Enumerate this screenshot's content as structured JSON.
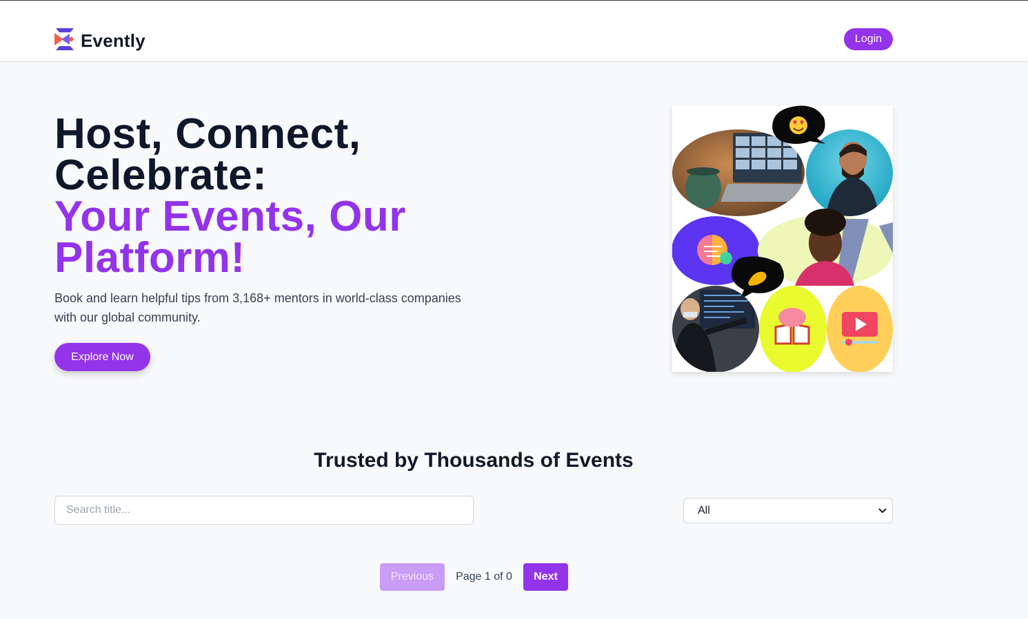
{
  "header": {
    "brand": "Evently",
    "login_label": "Login"
  },
  "hero": {
    "title_line1": "Host, Connect,",
    "title_line2": "Celebrate:",
    "accent_line1": "Your Events, Our",
    "accent_line2": "Platform!",
    "subtitle": "Book and learn helpful tips from 3,168+ mentors in world-class companies with our global community.",
    "cta_label": "Explore Now"
  },
  "events": {
    "section_title": "Trusted by Thousands of Events",
    "search_placeholder": "Search title...",
    "search_value": "",
    "category_selected": "All"
  },
  "pagination": {
    "prev_label": "Previous",
    "page_info": "Page 1 of 0",
    "next_label": "Next"
  },
  "colors": {
    "accent": "#9333ea",
    "accent_disabled": "#c99cf5",
    "title": "#0f172a"
  },
  "icons": [
    "evently-logo-icon",
    "chevron-down-icon",
    "heart-eyes-emoji-icon",
    "pinched-fingers-emoji-icon",
    "brain-gear-icon",
    "brain-book-icon",
    "play-video-icon"
  ]
}
